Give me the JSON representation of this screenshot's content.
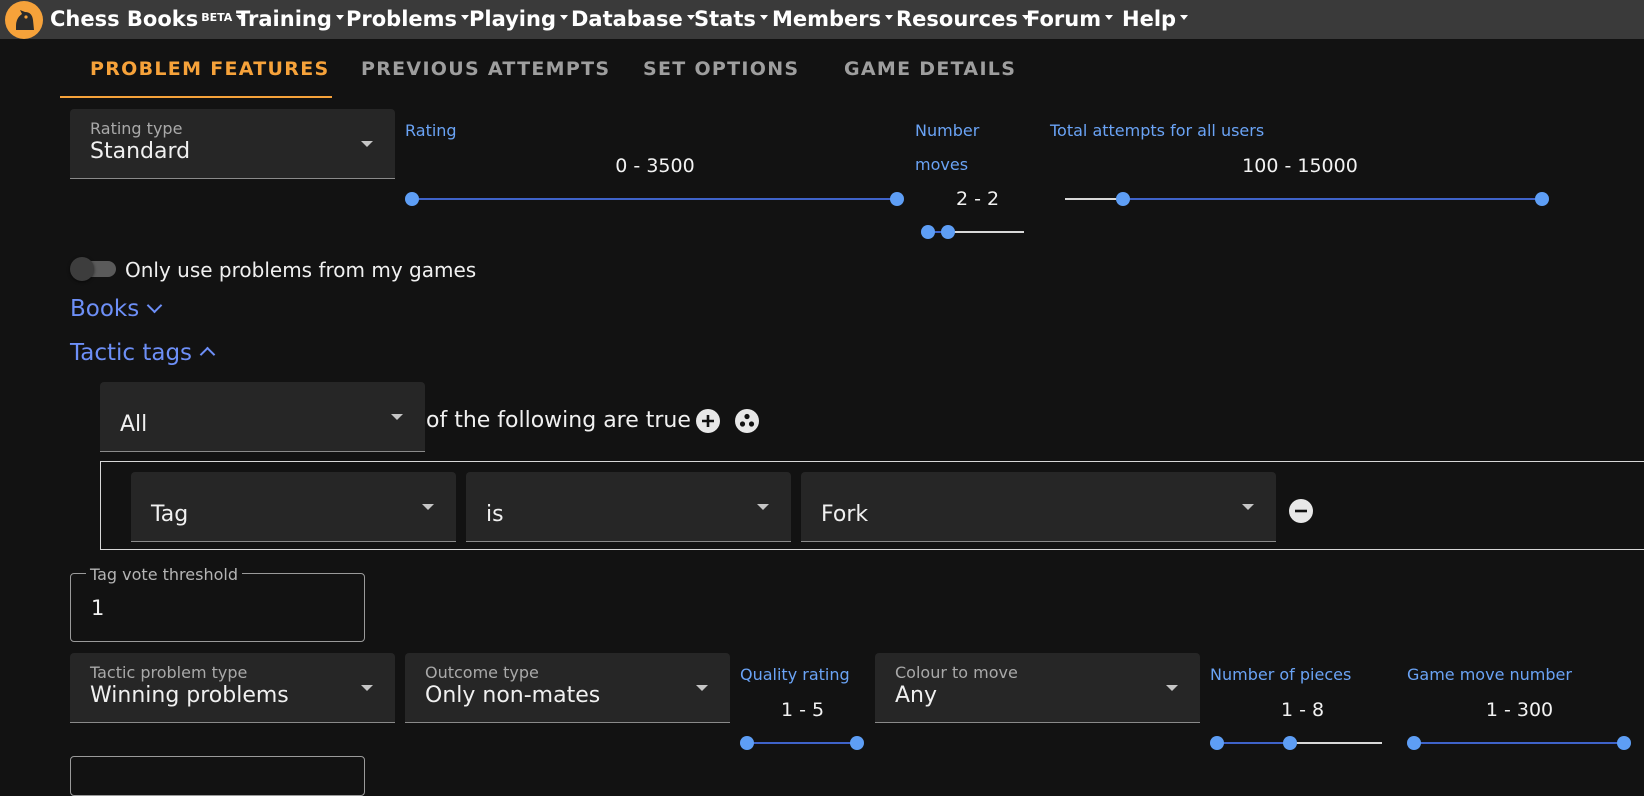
{
  "navbar": {
    "brand": "Chess Books",
    "brand_badge": "BETA",
    "items": [
      {
        "label": "Training"
      },
      {
        "label": "Problems"
      },
      {
        "label": "Playing"
      },
      {
        "label": "Database"
      },
      {
        "label": "Stats"
      },
      {
        "label": "Members"
      },
      {
        "label": "Resources"
      },
      {
        "label": "Forum"
      },
      {
        "label": "Help"
      }
    ]
  },
  "tabs": [
    {
      "label": "PROBLEM FEATURES",
      "active": true
    },
    {
      "label": "PREVIOUS ATTEMPTS",
      "active": false
    },
    {
      "label": "SET OPTIONS",
      "active": false
    },
    {
      "label": "GAME DETAILS",
      "active": false
    }
  ],
  "rating_type": {
    "label": "Rating type",
    "value": "Standard"
  },
  "rating": {
    "label": "Rating",
    "value_text": "0 - 3500",
    "min": 0,
    "max": 3500,
    "low": 0,
    "high": 3500
  },
  "number_moves": {
    "label_line1": "Number",
    "label_line2": "moves",
    "value_text": "2 - 2",
    "low": 2,
    "high": 2
  },
  "total_attempts": {
    "label": "Total attempts for all users",
    "value_text": "100 - 15000",
    "low": 100,
    "high": 15000
  },
  "my_games_toggle": {
    "label": "Only use problems from my games",
    "checked": false
  },
  "books_section": {
    "label": "Books",
    "expanded": false
  },
  "tactic_tags_section": {
    "label": "Tactic tags",
    "expanded": true
  },
  "tag_logic": {
    "select_value": "All",
    "text": "of the following are true"
  },
  "tag_rule": {
    "field": "Tag",
    "operator": "is",
    "value": "Fork"
  },
  "tag_vote_threshold": {
    "label": "Tag vote threshold",
    "value": "1"
  },
  "tactic_problem_type": {
    "label": "Tactic problem type",
    "value": "Winning problems"
  },
  "outcome_type": {
    "label": "Outcome type",
    "value": "Only non-mates"
  },
  "quality_rating": {
    "label": "Quality rating",
    "value_text": "1 - 5",
    "low": 1,
    "high": 5
  },
  "colour_to_move": {
    "label": "Colour to move",
    "value": "Any"
  },
  "number_of_pieces": {
    "label": "Number of pieces",
    "value_text": "1 - 8",
    "low": 1,
    "high": 8
  },
  "game_move_number": {
    "label": "Game move number",
    "value_text": "1 - 300",
    "low": 1,
    "high": 300
  },
  "colors": {
    "accent": "#f6a23a",
    "link": "#6d8ff7",
    "slider": "#5e9ef5"
  }
}
